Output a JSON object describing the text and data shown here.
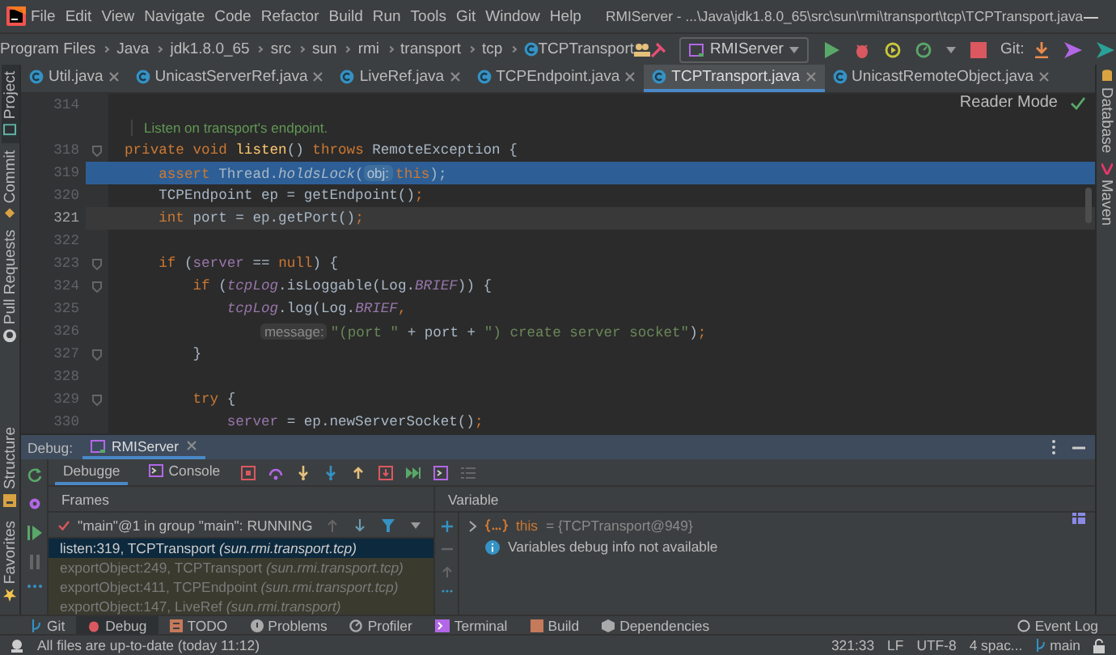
{
  "menu_bar": {
    "items": [
      "File",
      "Edit",
      "View",
      "Navigate",
      "Code",
      "Refactor",
      "Build",
      "Run",
      "Tools",
      "Git",
      "Window",
      "Help"
    ],
    "title": "RMIServer - ...\\Java\\jdk1.8.0_65\\src\\sun\\rmi\\transport\\tcp\\TCPTransport.java"
  },
  "navigation_bar": {
    "breadcrumbs": [
      "Program Files",
      "Java",
      "jdk1.8.0_65",
      "src",
      "sun",
      "rmi",
      "transport",
      "tcp",
      "TCPTransport"
    ],
    "run_configuration": "RMIServer",
    "git_label": "Git:"
  },
  "left_tool_strip": {
    "top": [
      "Project",
      "Commit",
      "Pull Requests"
    ],
    "bottom": [
      "Structure",
      "Favorites"
    ]
  },
  "right_tool_strip": [
    "Database",
    "Maven"
  ],
  "editor_tabs": [
    {
      "label": "Util.java",
      "selected": false
    },
    {
      "label": "UnicastServerRef.java",
      "selected": false
    },
    {
      "label": "LiveRef.java",
      "selected": false
    },
    {
      "label": "TCPEndpoint.java",
      "selected": false
    },
    {
      "label": "TCPTransport.java",
      "selected": true
    },
    {
      "label": "UnicastRemoteObject.java",
      "selected": false
    }
  ],
  "editor": {
    "reader_mode": "Reader Mode",
    "lines": [
      {
        "kind": "code",
        "number": "314",
        "execution": false,
        "current": false
      },
      {
        "kind": "doc",
        "text": "Listen on transport's endpoint."
      },
      {
        "kind": "code",
        "number": "318",
        "execution": false,
        "current": false,
        "tokens": [
          {
            "kind": "keyword",
            "t": "private void "
          },
          {
            "kind": "declaration",
            "t": "listen"
          },
          {
            "kind": "plain",
            "t": "() "
          },
          {
            "kind": "keyword",
            "t": "throws "
          },
          {
            "kind": "plain",
            "t": "RemoteException {"
          }
        ]
      },
      {
        "kind": "code",
        "number": "319",
        "execution": true,
        "current": false,
        "tokens": [
          {
            "kind": "keyword",
            "t": "    assert "
          },
          {
            "kind": "plain",
            "t": "Thread."
          },
          {
            "kind": "static_call",
            "t": "holdsLock"
          },
          {
            "kind": "plain",
            "t": "("
          },
          {
            "kind": "hint",
            "t": "obj:"
          },
          {
            "kind": "keyword",
            "t": "this"
          },
          {
            "kind": "plain",
            "t": ");"
          }
        ]
      },
      {
        "kind": "code",
        "number": "320",
        "execution": false,
        "current": false,
        "tokens": [
          {
            "kind": "plain",
            "t": "    TCPEndpoint ep = getEndpoint()"
          },
          {
            "kind": "keyword",
            "t": ";"
          }
        ]
      },
      {
        "kind": "code",
        "number": "321",
        "execution": false,
        "current": true,
        "tokens": [
          {
            "kind": "keyword",
            "t": "    int "
          },
          {
            "kind": "plain",
            "t": "port = ep.getPort()"
          },
          {
            "kind": "keyword",
            "t": ";"
          }
        ]
      },
      {
        "kind": "code",
        "number": "322",
        "execution": false,
        "current": false
      },
      {
        "kind": "code",
        "number": "323",
        "execution": false,
        "current": false,
        "tokens": [
          {
            "kind": "keyword",
            "t": "    if "
          },
          {
            "kind": "plain",
            "t": "("
          },
          {
            "kind": "field",
            "t": "server"
          },
          {
            "kind": "plain",
            "t": " == "
          },
          {
            "kind": "keyword",
            "t": "null"
          },
          {
            "kind": "plain",
            "t": ") {"
          }
        ]
      },
      {
        "kind": "code",
        "number": "324",
        "execution": false,
        "current": false,
        "tokens": [
          {
            "kind": "keyword",
            "t": "        if "
          },
          {
            "kind": "plain",
            "t": "("
          },
          {
            "kind": "static_field",
            "t": "tcpLog"
          },
          {
            "kind": "plain",
            "t": ".isLoggable(Log."
          },
          {
            "kind": "static_field",
            "t": "BRIEF"
          },
          {
            "kind": "plain",
            "t": ")) {"
          }
        ]
      },
      {
        "kind": "code",
        "number": "325",
        "execution": false,
        "current": false,
        "tokens": [
          {
            "kind": "static_field",
            "t": "            tcpLog"
          },
          {
            "kind": "plain",
            "t": ".log(Log."
          },
          {
            "kind": "static_field",
            "t": "BRIEF"
          },
          {
            "kind": "keyword",
            "t": ","
          }
        ]
      },
      {
        "kind": "code",
        "number": "326",
        "execution": false,
        "current": false,
        "tokens": [
          {
            "kind": "hint",
            "t": "                message:"
          },
          {
            "kind": "string",
            "t": "\"(port \""
          },
          {
            "kind": "plain",
            "t": " + port + "
          },
          {
            "kind": "string",
            "t": "\") create server socket\""
          },
          {
            "kind": "plain",
            "t": ")"
          },
          {
            "kind": "keyword",
            "t": ";"
          }
        ]
      },
      {
        "kind": "code",
        "number": "327",
        "execution": false,
        "current": false,
        "tokens": [
          {
            "kind": "plain",
            "t": "        }"
          }
        ]
      },
      {
        "kind": "code",
        "number": "328",
        "execution": false,
        "current": false
      },
      {
        "kind": "code",
        "number": "329",
        "execution": false,
        "current": false,
        "tokens": [
          {
            "kind": "keyword",
            "t": "        try "
          },
          {
            "kind": "plain",
            "t": "{"
          }
        ]
      },
      {
        "kind": "code",
        "number": "330",
        "execution": false,
        "current": false,
        "tokens": [
          {
            "kind": "field",
            "t": "            server"
          },
          {
            "kind": "plain",
            "t": " = ep.newServerSocket()"
          },
          {
            "kind": "keyword",
            "t": ";"
          }
        ]
      }
    ]
  },
  "debug": {
    "title": "Debug:",
    "session_tab": "RMIServer",
    "tabs": [
      {
        "label": "Debugge",
        "selected": true
      },
      {
        "label": "Console",
        "selected": false
      }
    ],
    "frames": {
      "title": "Frames",
      "thread": "\"main\"@1 in group \"main\": RUNNING",
      "items": [
        {
          "text": "listen:319, TCPTransport *(sun.rmi.transport.tcp)*",
          "selected": true,
          "library": false
        },
        {
          "text": "exportObject:249, TCPTransport *(sun.rmi.transport.tcp)*",
          "selected": false,
          "library": true
        },
        {
          "text": "exportObject:411, TCPEndpoint *(sun.rmi.transport.tcp)*",
          "selected": false,
          "library": true
        },
        {
          "text": "exportObject:147, LiveRef *(sun.rmi.transport)*",
          "selected": false,
          "library": true
        }
      ]
    },
    "variables": {
      "title": "Variable",
      "items": [
        {
          "kind": "object",
          "name": "this",
          "value": "= {TCPTransport@949}"
        },
        {
          "kind": "info",
          "text": "Variables debug info not available"
        }
      ]
    }
  },
  "tool_window_bar": {
    "items": [
      {
        "label": "Git",
        "selected": false
      },
      {
        "label": "Debug",
        "selected": true
      },
      {
        "label": "TODO",
        "selected": false
      },
      {
        "label": "Problems",
        "selected": false
      },
      {
        "label": "Profiler",
        "selected": false
      },
      {
        "label": "Terminal",
        "selected": false
      },
      {
        "label": "Build",
        "selected": false
      },
      {
        "label": "Dependencies",
        "selected": false
      }
    ],
    "event_log": "Event Log"
  },
  "status_bar": {
    "message": "All files are up-to-date (today 11:12)",
    "position": "321:33",
    "line_separator": "LF",
    "encoding": "UTF-8",
    "indent": "4 spac...",
    "branch": "main"
  }
}
